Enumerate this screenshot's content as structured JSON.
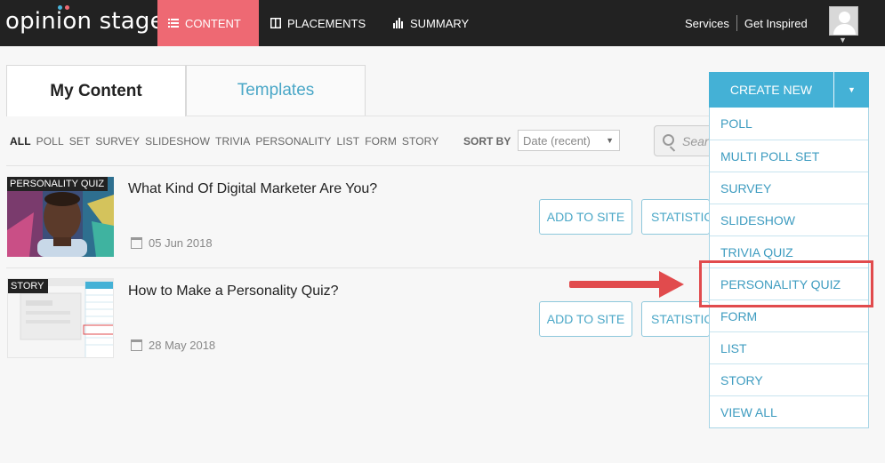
{
  "header": {
    "logo": "opinion stage",
    "logo_dot_colors": [
      "#4ab5da",
      "#ee6973"
    ],
    "tabs": [
      {
        "label": "CONTENT",
        "icon": "list-icon",
        "active": true
      },
      {
        "label": "PLACEMENTS",
        "icon": "layout-icon",
        "active": false
      },
      {
        "label": "SUMMARY",
        "icon": "bar-chart-icon",
        "active": false
      }
    ],
    "links": [
      "Services",
      "Get Inspired"
    ],
    "avatar_icon": "user-avatar-icon",
    "avatar_caret_icon": "chevron-down-icon",
    "accent_color": "#ee6973"
  },
  "content_tabs": [
    {
      "label": "My Content",
      "active": true
    },
    {
      "label": "Templates",
      "active": false
    }
  ],
  "filters": [
    "ALL",
    "POLL",
    "SET",
    "SURVEY",
    "SLIDESHOW",
    "TRIVIA",
    "PERSONALITY",
    "LIST",
    "FORM",
    "STORY"
  ],
  "sort": {
    "label": "SORT BY",
    "value": "Date (recent)"
  },
  "search": {
    "placeholder": "Search"
  },
  "items": [
    {
      "badge": "PERSONALITY QUIZ",
      "title": "What Kind Of Digital Marketer Are You?",
      "date": "05 Jun 2018",
      "add_label": "ADD TO SITE",
      "stats_label": "STATISTICS"
    },
    {
      "badge": "STORY",
      "title": "How to Make a Personality Quiz?",
      "date": "28 May 2018",
      "add_label": "ADD TO SITE",
      "stats_label": "STATISTICS"
    }
  ],
  "create": {
    "label": "CREATE NEW",
    "color": "#44b1d6",
    "options": [
      "POLL",
      "MULTI POLL SET",
      "SURVEY",
      "SLIDESHOW",
      "TRIVIA QUIZ",
      "PERSONALITY QUIZ",
      "FORM",
      "LIST",
      "STORY",
      "VIEW ALL"
    ]
  },
  "annotation": {
    "highlighted_option": "PERSONALITY QUIZ",
    "color": "#e14b4d"
  }
}
